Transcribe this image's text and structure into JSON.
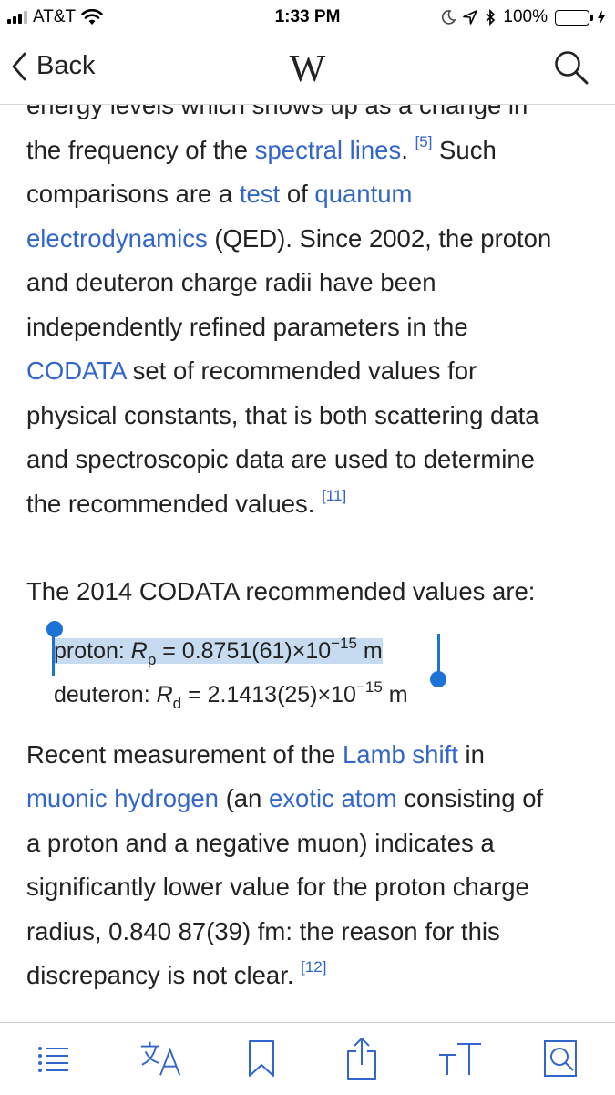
{
  "status": {
    "carrier": "AT&T",
    "time": "1:33 PM",
    "battery": "100%",
    "battery_level": 1.0
  },
  "nav": {
    "back_label": "Back",
    "logo": "W"
  },
  "article": {
    "p1": {
      "l1": "energy levels which shows up as a change in",
      "l2a": "the frequency of the ",
      "l2_link": "spectral lines",
      "l2b": ".",
      "l2_ref": "[5]",
      "l2c": " Such",
      "l3a": "comparisons are a ",
      "l3_link1": "test",
      "l3b": " of ",
      "l3_link2": "quantum",
      "l4_link": "electrodynamics",
      "l4b": " (QED). Since 2002, the proton",
      "l5": "and deuteron charge radii have been",
      "l6": "independently refined parameters in the",
      "l7_link": "CODATA",
      "l7b": " set of recommended values for",
      "l8": "physical constants, that is both scattering data",
      "l9": "and spectroscopic data are used to determine",
      "l10": "the recommended values.",
      "l10_ref": "[11]"
    },
    "p2": "The 2014 CODATA recommended values are:",
    "formula": {
      "proton_label": "proton: ",
      "proton_sym": "R",
      "proton_sub": "p",
      "proton_val": " = 0.8751(61)×10",
      "proton_exp": "−15",
      "proton_unit": " m",
      "deuteron_label": "deuteron: ",
      "deuteron_sym": "R",
      "deuteron_sub": "d",
      "deuteron_val": " = 2.1413(25)×10",
      "deuteron_exp": "−15",
      "deuteron_unit": " m"
    },
    "p3": {
      "l1a": "Recent measurement of the ",
      "l1_link": "Lamb shift",
      "l1b": " in",
      "l2_link1": "muonic hydrogen",
      "l2b": " (an ",
      "l2_link2": "exotic atom",
      "l2c": " consisting of",
      "l3": "a proton and a negative muon) indicates a",
      "l4": "significantly lower value for the proton charge",
      "l5": "radius, 0.840 87(39) fm: the reason for this",
      "l6": "discrepancy is not clear.",
      "l6_ref": "[12]"
    }
  },
  "toolbar": {
    "icons": [
      "contents-icon",
      "language-icon",
      "bookmark-icon",
      "share-icon",
      "text-size-icon",
      "find-in-page-icon"
    ]
  },
  "colors": {
    "link": "#3366cc",
    "selection": "#c6dbef",
    "selection_handle": "#1d72d6",
    "battery": "#4cd964"
  }
}
